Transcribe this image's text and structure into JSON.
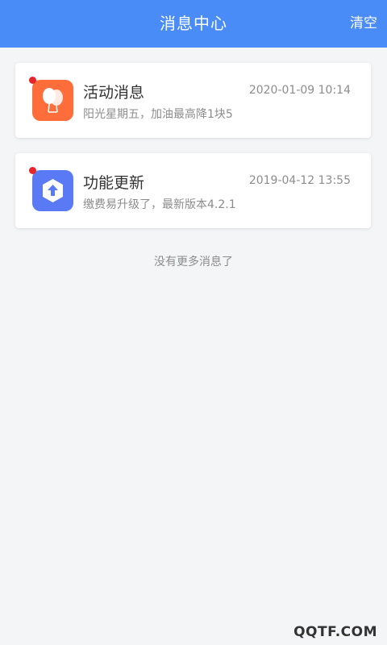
{
  "header": {
    "title": "消息中心",
    "action_label": "清空",
    "background": "#4a8cf7"
  },
  "messages": [
    {
      "title": "活动消息",
      "subtitle": "阳光星期五，加油最高降1块5",
      "time": "2020-01-09 10:14",
      "icon": "balloon-icon",
      "icon_color": "#ff6d3b",
      "unread": true
    },
    {
      "title": "功能更新",
      "subtitle": "缴费易升级了，最新版本4.2.1",
      "time": "2019-04-12 13:55",
      "icon": "upgrade-arrow-icon",
      "icon_color": "#5a79f5",
      "unread": true
    }
  ],
  "footer": {
    "no_more_text": "没有更多消息了"
  },
  "watermark": "QQTF.COM",
  "colors": {
    "unread_dot": "#e8242b",
    "page_background": "#f4f5f7"
  }
}
